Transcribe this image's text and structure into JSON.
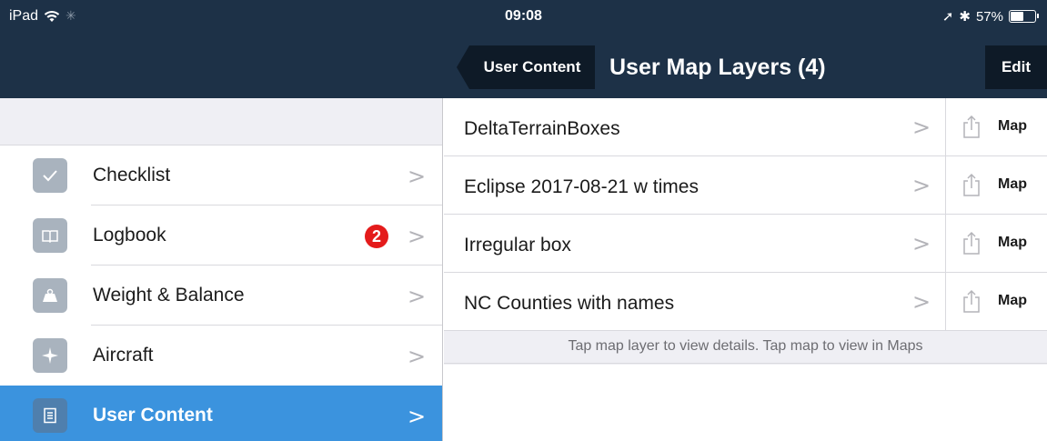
{
  "status": {
    "device": "iPad",
    "time": "09:08",
    "battery": "57%",
    "battery_level": 0.57
  },
  "nav": {
    "back_label": "User Content",
    "title": "User Map Layers (4)",
    "edit_label": "Edit"
  },
  "sidebar": {
    "items": [
      {
        "label": "Checklist",
        "icon": "checkmark-icon"
      },
      {
        "label": "Logbook",
        "icon": "book-icon",
        "badge": "2"
      },
      {
        "label": "Weight & Balance",
        "icon": "weight-icon"
      },
      {
        "label": "Aircraft",
        "icon": "airplane-icon"
      },
      {
        "label": "User Content",
        "icon": "document-icon"
      }
    ]
  },
  "layers": {
    "rows": [
      {
        "name": "DeltaTerrainBoxes",
        "action": "Map"
      },
      {
        "name": "Eclipse 2017-08-21 w times",
        "action": "Map"
      },
      {
        "name": "Irregular box",
        "action": "Map"
      },
      {
        "name": "NC Counties with names",
        "action": "Map"
      }
    ],
    "footer": "Tap map layer to view details. Tap map to view in Maps"
  },
  "colors": {
    "bar": "#1d3147",
    "accent": "#3b93de",
    "badge": "#e41b1b"
  }
}
